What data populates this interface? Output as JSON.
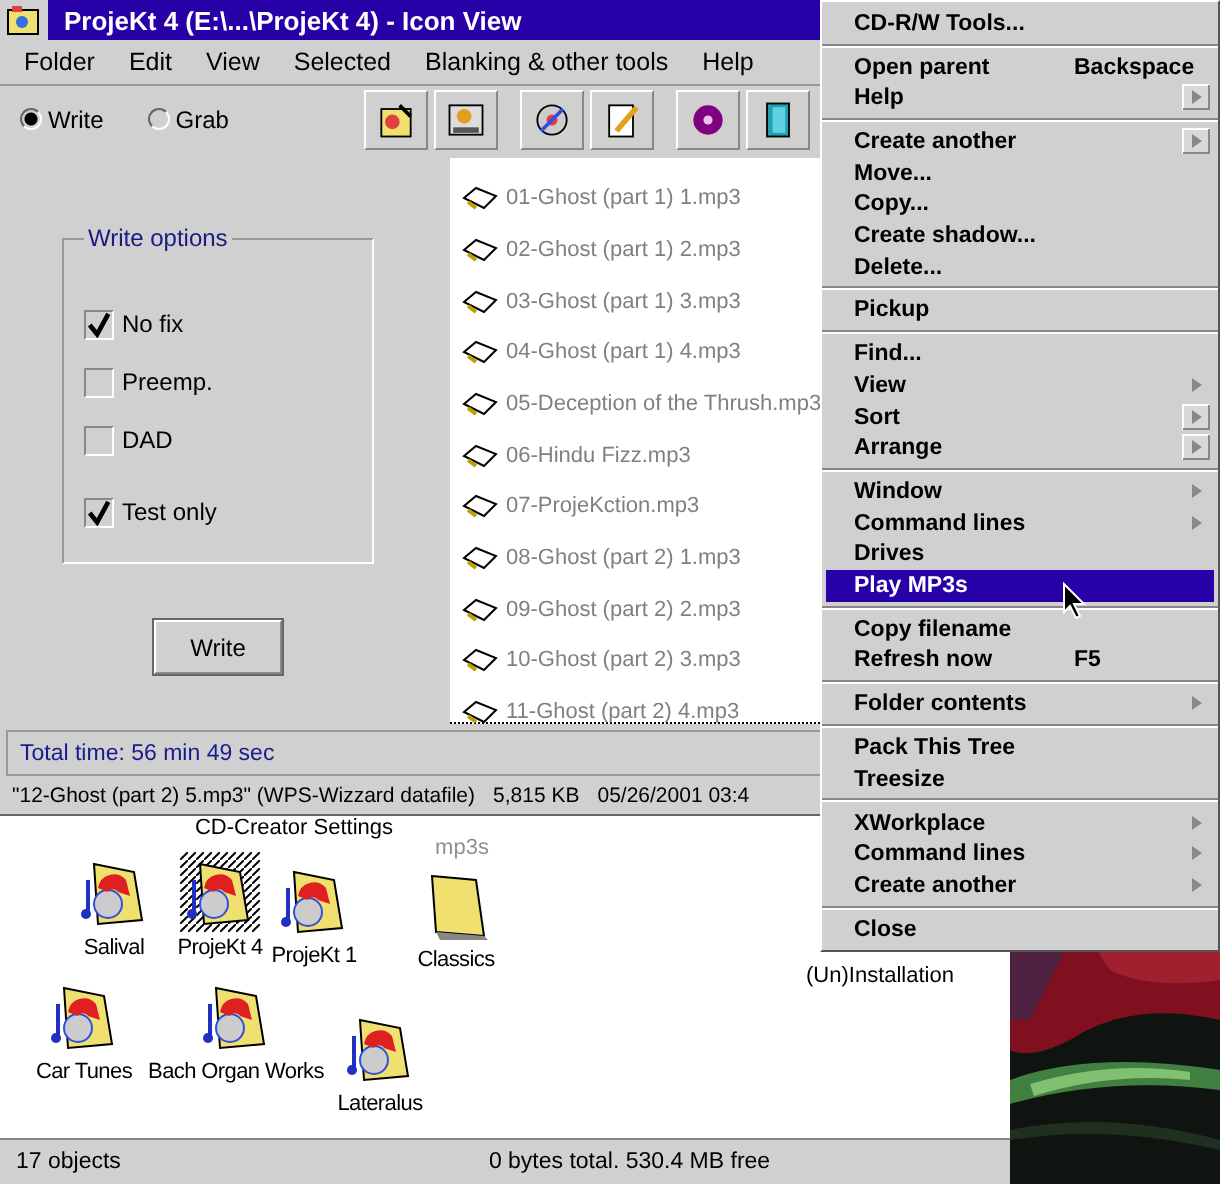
{
  "window": {
    "title": "ProjeKt 4 (E:\\...\\ProjeKt 4) - Icon View",
    "menu": [
      "Folder",
      "Edit",
      "View",
      "Selected",
      "Blanking & other tools",
      "Help"
    ],
    "radios": [
      {
        "label": "Write",
        "selected": true
      },
      {
        "label": "Grab",
        "selected": false
      }
    ],
    "write_options": {
      "title": "Write options",
      "checkboxes": [
        {
          "label": "No fix",
          "checked": true
        },
        {
          "label": "Preemp.",
          "checked": false
        },
        {
          "label": "DAD",
          "checked": false
        },
        {
          "label": "Test only",
          "checked": true
        }
      ]
    },
    "write_button": "Write",
    "files": [
      "01-Ghost (part 1) 1.mp3",
      "02-Ghost (part 1) 2.mp3",
      "03-Ghost (part 1) 3.mp3",
      "04-Ghost (part 1) 4.mp3",
      "05-Deception of the Thrush.mp3",
      "06-Hindu Fizz.mp3",
      "07-ProjeKction.mp3",
      "08-Ghost (part 2) 1.mp3",
      "09-Ghost (part 2) 2.mp3",
      "10-Ghost (part 2) 3.mp3",
      "11-Ghost (part 2) 4.mp3"
    ],
    "total_time": "Total time: 56 min 49 sec",
    "info": {
      "name": "\"12-Ghost (part 2) 5.mp3\" (WPS-Wizzard datafile)",
      "size": "5,815 KB",
      "date": "05/26/2001 03:4"
    }
  },
  "folder": {
    "partial_labels": [
      {
        "label": "CD-Creator Settings",
        "dimmed": false
      },
      {
        "label": "mp3s",
        "dimmed": true
      },
      {
        "label": "(Un)Installation",
        "dimmed": false
      }
    ],
    "icons": [
      {
        "label": "Salival",
        "kind": "music-folder",
        "selected": false
      },
      {
        "label": "ProjeKt 4",
        "kind": "music-folder",
        "selected": true
      },
      {
        "label": "ProjeKt 1",
        "kind": "music-folder",
        "selected": false
      },
      {
        "label": "Classics",
        "kind": "folder",
        "selected": false
      },
      {
        "label": "Car Tunes",
        "kind": "music-folder",
        "selected": false
      },
      {
        "label": "Bach Organ Works",
        "kind": "music-folder",
        "selected": false
      },
      {
        "label": "Lateralus",
        "kind": "music-folder",
        "selected": false
      }
    ],
    "status": [
      "17 objects",
      "0 bytes total. 530.4 MB free"
    ]
  },
  "context_menu": {
    "groups": [
      {
        "items": [
          {
            "label": "CD-R/W Tools...",
            "kind": "command",
            "selected": false
          }
        ]
      },
      {
        "items": [
          {
            "label": "Open parent",
            "kind": "command",
            "shortcut": "Backspace",
            "selected": false
          },
          {
            "label": "Help",
            "kind": "cascade",
            "selected": false
          }
        ]
      },
      {
        "items": [
          {
            "label": "Create another",
            "kind": "cascade",
            "selected": false
          },
          {
            "label": "Move...",
            "kind": "command",
            "selected": false
          },
          {
            "label": "Copy...",
            "kind": "command",
            "selected": false
          },
          {
            "label": "Create shadow...",
            "kind": "command",
            "selected": false
          },
          {
            "label": "Delete...",
            "kind": "command",
            "selected": false
          }
        ]
      },
      {
        "items": [
          {
            "label": "Pickup",
            "kind": "command",
            "selected": false
          }
        ]
      },
      {
        "items": [
          {
            "label": "Find...",
            "kind": "command",
            "selected": false
          },
          {
            "label": "View",
            "kind": "submenu",
            "selected": false
          },
          {
            "label": "Sort",
            "kind": "cascade",
            "selected": false
          },
          {
            "label": "Arrange",
            "kind": "cascade",
            "selected": false
          }
        ]
      },
      {
        "items": [
          {
            "label": "Window",
            "kind": "submenu",
            "selected": false
          },
          {
            "label": "Command lines",
            "kind": "submenu",
            "selected": false
          },
          {
            "label": "Drives",
            "kind": "command",
            "selected": false
          },
          {
            "label": "Play MP3s",
            "kind": "command",
            "selected": true
          }
        ]
      },
      {
        "items": [
          {
            "label": "Copy filename",
            "kind": "command",
            "selected": false
          },
          {
            "label": "Refresh now",
            "kind": "command",
            "shortcut": "F5",
            "selected": false
          }
        ]
      },
      {
        "items": [
          {
            "label": "Folder contents",
            "kind": "submenu",
            "selected": false
          }
        ]
      },
      {
        "items": [
          {
            "label": "Pack This Tree",
            "kind": "command",
            "selected": false
          },
          {
            "label": "Treesize",
            "kind": "command",
            "selected": false
          }
        ]
      },
      {
        "items": [
          {
            "label": "XWorkplace",
            "kind": "submenu",
            "selected": false
          },
          {
            "label": "Command lines",
            "kind": "submenu",
            "selected": false
          },
          {
            "label": "Create another",
            "kind": "submenu",
            "selected": false
          }
        ]
      },
      {
        "items": [
          {
            "label": "Close",
            "kind": "command",
            "selected": false
          }
        ]
      }
    ]
  }
}
